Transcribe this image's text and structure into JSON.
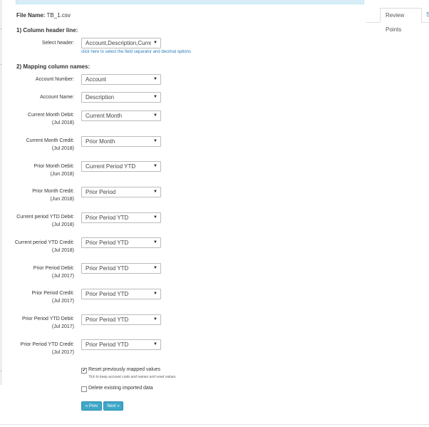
{
  "file": {
    "label": "File Name:",
    "value": "TB_1.csv"
  },
  "tabs": {
    "active": "Review Points",
    "next": "S"
  },
  "section1": {
    "title": "1) Column header line:",
    "select_label": "Select header:",
    "select_value": "Account,Description,Curre",
    "hint_link": "click here to select the field separator and decimal options"
  },
  "section2": {
    "title": "2) Mapping column names:",
    "rows": [
      {
        "label": "Account Number:",
        "sub": "",
        "value": "Account"
      },
      {
        "label": "Account Name:",
        "sub": "",
        "value": "Description"
      },
      {
        "label": "Current Month Debit:",
        "sub": "(Jul 2018)",
        "value": "Current Month"
      },
      {
        "label": "Current Month Credit:",
        "sub": "(Jul 2018)",
        "value": "Prior Month"
      },
      {
        "label": "Prior Month Debit:",
        "sub": "(Jun 2018)",
        "value": "Current Period YTD"
      },
      {
        "label": "Prior Month Credit:",
        "sub": "(Jun 2018)",
        "value": "Prior Period"
      },
      {
        "label": "Current period YTD Debit:",
        "sub": "(Jul 2018)",
        "value": "Prior Period YTD"
      },
      {
        "label": "Current period YTD Credit:",
        "sub": "(Jul 2018)",
        "value": "Prior Period YTD"
      },
      {
        "label": "Prior Period Debit:",
        "sub": "(Jul 2017)",
        "value": "Prior Period YTD"
      },
      {
        "label": "Prior Period Credit:",
        "sub": "(Jul 2017)",
        "value": "Prior Period YTD"
      },
      {
        "label": "Prior Period YTD Debit:",
        "sub": "(Jul 2017)",
        "value": "Prior Period YTD"
      },
      {
        "label": "Prior Period YTD Credit:",
        "sub": "(Jul 2017)",
        "value": "Prior Period YTD"
      }
    ]
  },
  "options": {
    "reset_label": "Reset previously mapped values",
    "reset_checked_glyph": "✔",
    "reset_hint": "Tick to keep account code and names and reset values.",
    "delete_label": "Delete existing imported data"
  },
  "buttons": {
    "prev": "« Prev",
    "next": "Next »"
  },
  "icons": {
    "caret": "▼"
  },
  "colors": {
    "accent": "#3fa7c8",
    "link": "#2a7bb8",
    "banner": "#d9edf7"
  }
}
